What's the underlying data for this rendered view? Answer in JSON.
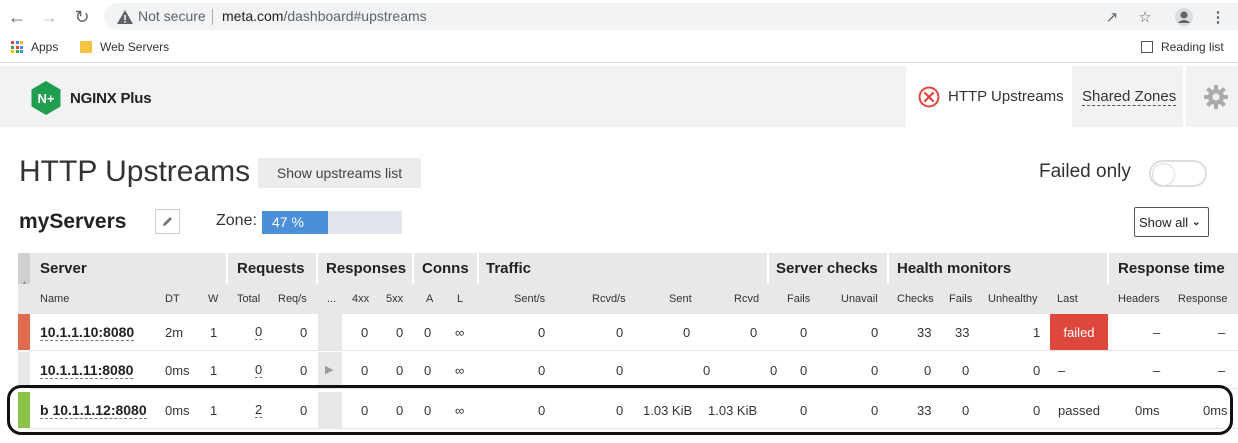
{
  "browser": {
    "not_secure": "Not secure",
    "url_host": "meta.com",
    "url_path": "/dashboard#upstreams",
    "bookmarks": {
      "apps": "Apps",
      "web_servers": "Web Servers",
      "reading_list": "Reading list"
    }
  },
  "header": {
    "logo_badge": "N+",
    "logo_text": "NGINX Plus",
    "tab_active": "HTTP Upstreams",
    "tab_shared": "Shared Zones",
    "colors": {
      "logo_green": "#1f9e4f",
      "error_red": "#e0473c"
    }
  },
  "page": {
    "title": "HTTP Upstreams",
    "show_list_button": "Show upstreams list",
    "failed_only_label": "Failed only",
    "failed_only_enabled": false
  },
  "upstream": {
    "name": "myServers",
    "zone_label": "Zone:",
    "zone_usage_text": "47 %",
    "zone_usage_fraction": 0.47,
    "filter_select": "Show all"
  },
  "table": {
    "groups": {
      "server": "Server",
      "requests": "Requests",
      "responses": "Responses",
      "conns": "Conns",
      "traffic": "Traffic",
      "server_checks": "Server checks",
      "health_monitors": "Health monitors",
      "response_time": "Response time"
    },
    "columns": {
      "name": "Name",
      "dt": "DT",
      "w": "W",
      "total": "Total",
      "reqs": "Req/s",
      "dots": "...",
      "r4xx": "4xx",
      "r5xx": "5xx",
      "a": "A",
      "l": "L",
      "sent_s": "Sent/s",
      "rcvd_s": "Rcvd/s",
      "sent": "Sent",
      "rcvd": "Rcvd",
      "fails": "Fails",
      "unavail": "Unavail",
      "checks": "Checks",
      "hm_fails": "Fails",
      "unhealthy": "Unhealthy",
      "last": "Last",
      "headers": "Headers",
      "response": "Response"
    },
    "rows": [
      {
        "status_color": "#e06c4e",
        "server": "10.1.1.10:8080",
        "dt": "2m",
        "w": "1",
        "total": "0",
        "reqs": "0",
        "r4xx": "0",
        "r5xx": "0",
        "a": "0",
        "l": "∞",
        "sent_s": "0",
        "rcvd_s": "0",
        "sent": "0",
        "rcvd": "0",
        "fails": "0",
        "unavail": "0",
        "checks": "33",
        "hm_fails": "33",
        "unhealthy": "1",
        "last": "failed",
        "headers": "–",
        "response": "–"
      },
      {
        "status_color": "#e8e8e8",
        "server": "10.1.1.11:8080",
        "dt": "0ms",
        "w": "1",
        "total": "0",
        "reqs": "0",
        "r4xx": "0",
        "r5xx": "0",
        "a": "0",
        "l": "∞",
        "sent_s": "0",
        "rcvd_s": "0",
        "sent": "0",
        "rcvd": "0",
        "fails": "0",
        "unavail": "0",
        "checks": "0",
        "hm_fails": "0",
        "unhealthy": "0",
        "last": "–",
        "headers": "–",
        "response": "–"
      },
      {
        "status_color": "#8bc34a",
        "server": "b 10.1.1.12:8080",
        "dt": "0ms",
        "w": "1",
        "total": "2",
        "reqs": "0",
        "r4xx": "0",
        "r5xx": "0",
        "a": "0",
        "l": "∞",
        "sent_s": "0",
        "rcvd_s": "0",
        "sent": "1.03 KiB",
        "rcvd": "1.03 KiB",
        "fails": "0",
        "unavail": "0",
        "checks": "33",
        "hm_fails": "0",
        "unhealthy": "0",
        "last": "passed",
        "headers": "0ms",
        "response": "0ms"
      }
    ]
  }
}
